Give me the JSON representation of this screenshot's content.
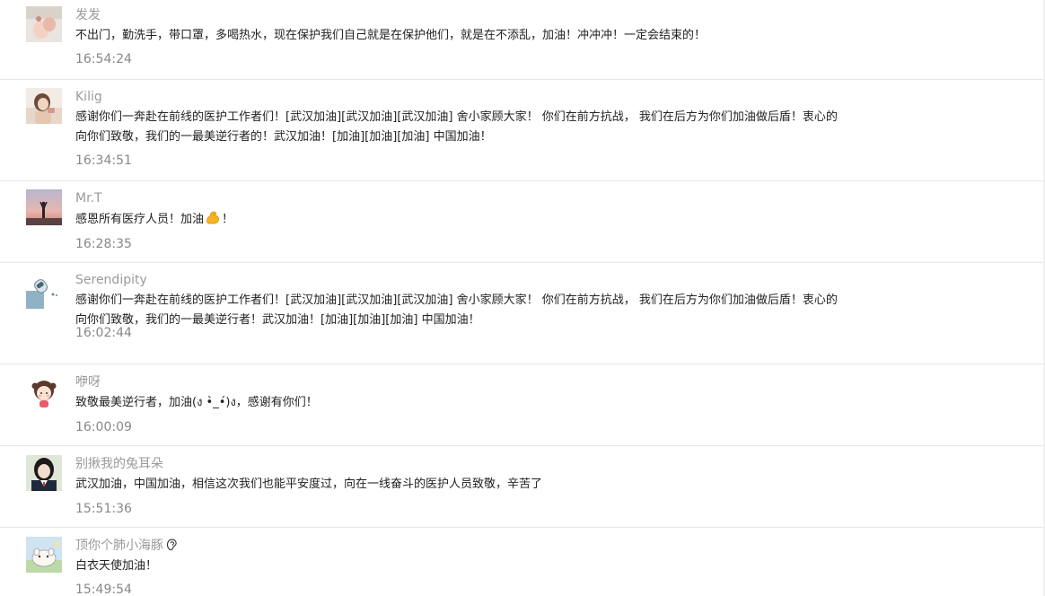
{
  "comments": [
    {
      "author": "发发",
      "avatar_icon": "avatar-photo-hand-icon",
      "lines": [
        "不出门，勤洗手，带口罩，多喝热水，现在保护我们自己就是在保护他们，就是在不添乱，加油！冲冲冲！一定会结束的！"
      ],
      "time": "16:54:24"
    },
    {
      "author": "Kilig",
      "avatar_icon": "avatar-photo-girl-icon",
      "lines": [
        "感谢你们一奔赴在前线的医护工作者们！[武汉加油][武汉加油][武汉加油] 舍小家顾大家！ 你们在前方抗战， 我们在后方为你们加油做后盾！衷心的",
        "向你们致敬，我们的一最美逆行者的！武汉加油！[加油][加油][加油] 中国加油！"
      ],
      "time": "16:34:51"
    },
    {
      "author": "Mr.T",
      "avatar_icon": "avatar-photo-sunset-icon",
      "text_before_emoji": "感恩所有医疗人员！加油",
      "emoji": "flexed-biceps-icon",
      "text_after_emoji": "！",
      "time": "16:28:35"
    },
    {
      "author": "Serendipity",
      "avatar_icon": "avatar-astronaut-icon",
      "lines": [
        "感谢你们一奔赴在前线的医护工作者们！[武汉加油][武汉加油][武汉加油] 舍小家顾大家！ 你们在前方抗战， 我们在后方为你们加油做后盾！衷心的",
        "向你们致敬，我们的一最美逆行者！武汉加油！[加油][加油][加油] 中国加油！"
      ],
      "time": "16:02:44"
    },
    {
      "author": "咿呀",
      "avatar_icon": "avatar-cartoon-girl-icon",
      "lines": [
        "致敬最美逆行者，加油(ง •̀_•́)ง，感谢有你们！"
      ],
      "time": "16:00:09"
    },
    {
      "author": "别揪我的兔耳朵",
      "avatar_icon": "avatar-photo-student-icon",
      "lines": [
        "武汉加油，中国加油，相信这次我们也能平安度过，向在一线奋斗的医护人员致敬，辛苦了"
      ],
      "time": "15:51:36"
    },
    {
      "author": "顶你个肺小海豚",
      "author_emoji": "ear-icon",
      "avatar_icon": "avatar-cartoon-animal-icon",
      "lines": [
        "白衣天使加油！"
      ],
      "time": "15:49:54"
    }
  ],
  "colors": {
    "author": "#9a9a9a",
    "text": "#222222",
    "time": "#888888",
    "divider": "#e6e6e6"
  }
}
